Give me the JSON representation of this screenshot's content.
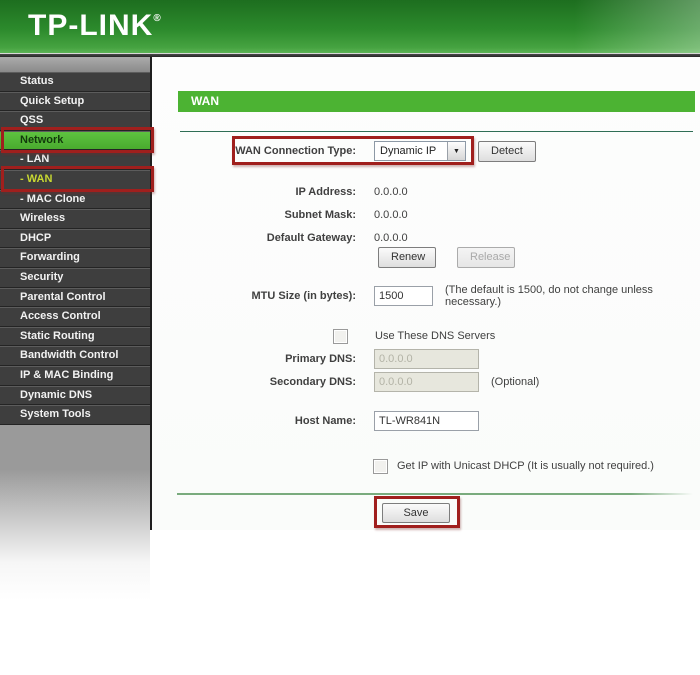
{
  "colors": {
    "accent": "#4cb333",
    "annotation": "#a01f1d",
    "sidebar-highlight": "#52b43c",
    "active-link": "#c8d832"
  },
  "header": {
    "logo": "TP-LINK",
    "registered_mark": "®"
  },
  "sidebar": {
    "items": [
      {
        "label": "Status"
      },
      {
        "label": "Quick Setup"
      },
      {
        "label": "QSS"
      },
      {
        "label": "Network",
        "state": "selected-parent",
        "annotated": true
      },
      {
        "label": "- LAN",
        "submenu": true
      },
      {
        "label": "- WAN",
        "submenu": true,
        "state": "selected-sub",
        "annotated": true
      },
      {
        "label": "- MAC Clone",
        "submenu": true
      },
      {
        "label": "Wireless"
      },
      {
        "label": "DHCP"
      },
      {
        "label": "Forwarding"
      },
      {
        "label": "Security"
      },
      {
        "label": "Parental Control"
      },
      {
        "label": "Access Control"
      },
      {
        "label": "Static Routing"
      },
      {
        "label": "Bandwidth Control"
      },
      {
        "label": "IP & MAC Binding"
      },
      {
        "label": "Dynamic DNS"
      },
      {
        "label": "System Tools"
      }
    ]
  },
  "main": {
    "page_title": "WAN",
    "connection_type": {
      "label": "WAN Connection Type:",
      "selected_option": "Dynamic IP",
      "dropdown_arrow": "▼",
      "detect_button": "Detect"
    },
    "ip_address": {
      "label": "IP Address:",
      "value": "0.0.0.0"
    },
    "subnet_mask": {
      "label": "Subnet Mask:",
      "value": "0.0.0.0"
    },
    "default_gateway": {
      "label": "Default Gateway:",
      "value": "0.0.0.0"
    },
    "renew_button": "Renew",
    "release_button": "Release",
    "mtu": {
      "label": "MTU Size (in bytes):",
      "value": "1500",
      "note": "(The default is 1500, do not change unless necessary.)"
    },
    "dns": {
      "use_dns_label": "Use These DNS Servers",
      "primary_label": "Primary DNS:",
      "primary_value": "0.0.0.0",
      "secondary_label": "Secondary DNS:",
      "secondary_value": "0.0.0.0",
      "secondary_note": "(Optional)"
    },
    "host_name": {
      "label": "Host Name:",
      "value": "TL-WR841N"
    },
    "unicast_label": "Get IP with Unicast DHCP (It is usually not required.)",
    "save_button": "Save"
  }
}
